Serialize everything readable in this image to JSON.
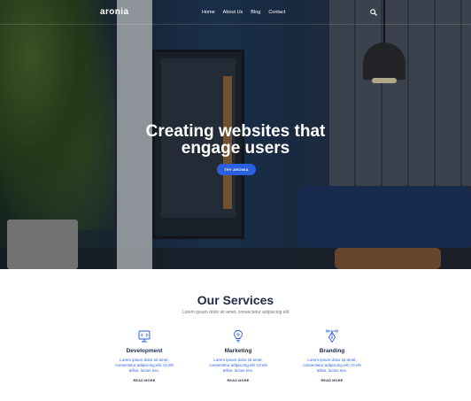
{
  "nav": {
    "logo": "aronia",
    "links": [
      "Home",
      "About Us",
      "Blog",
      "Contact"
    ],
    "search_icon": "search-icon"
  },
  "hero": {
    "title_line1": "Creating websites that",
    "title_line2": "engage users",
    "cta_label": "TRY ARONIA"
  },
  "services": {
    "title": "Our Services",
    "subtitle": "Lorem ipsum dolor sit amet, consectetur adipiscing elit",
    "items": [
      {
        "icon": "monitor-code-icon",
        "name": "Development",
        "text": "Lorem ipsum dolor sit amet, consectetur adipiscing elit. Ut elit tellus, luctus nec.",
        "link": "READ MORE"
      },
      {
        "icon": "lightbulb-icon",
        "name": "Marketing",
        "text": "Lorem ipsum dolor sit amet, consectetur adipiscing elit. Ut elit tellus, luctus nec.",
        "link": "READ MORE"
      },
      {
        "icon": "pen-tool-icon",
        "name": "Branding",
        "text": "Lorem ipsum dolor sit amet, consectetur adipiscing elit. Ut elit tellus, luctus nec.",
        "link": "READ MORE"
      }
    ]
  },
  "colors": {
    "accent": "#2a5fe0",
    "heading": "#1f2a44"
  }
}
